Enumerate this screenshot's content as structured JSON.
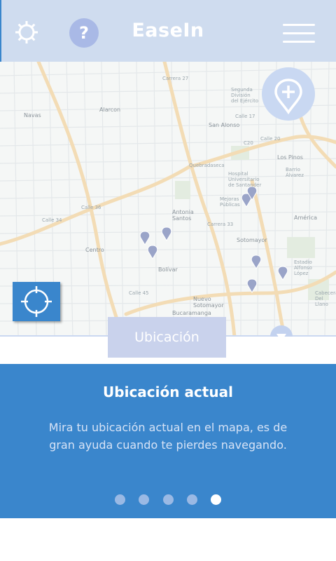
{
  "header": {
    "title": "EaseIn",
    "help_label": "?",
    "icons": [
      "gear-icon",
      "help-icon",
      "menu-icon"
    ]
  },
  "map": {
    "zoom_icon": "plus-pin-icon",
    "locate_icon": "crosshair-icon",
    "location_button": "Ubicación",
    "down_icon": "chevron-down-icon",
    "labels": {
      "navas": "Navas",
      "alarcon": "Alarcon",
      "san_alonso": "San Alonso",
      "segunda_division": "Segunda División del Ejército",
      "los_pinos": "Los Pinos",
      "barrio_alvarez": "Barrio Álvarez",
      "mejoras_publicas": "Mejoras Públicas",
      "hospital": "Hospital Universitario de Santander",
      "antonia_santos": "Antonia Santos",
      "sotomayor": "Sotomayor",
      "centro": "Centro",
      "bolivar": "Bolívar",
      "america": "América",
      "nuevo_sotomayor": "Nuevo Sotomayor",
      "bucaramanga": "Bucaramanga",
      "cabecera": "Cabecera Del Llano",
      "estadio": "Estadio Alfonso López",
      "calle_20": "Calle 20",
      "c20": "C20",
      "quebradaseca": "Quebradaseca",
      "carrera_27": "Carrera 27",
      "carrera_33": "Carrera 33",
      "calle_45": "Calle 45",
      "calle_36": "Calle 36",
      "calle_34": "Calle 34",
      "calle_17": "Calle 17"
    }
  },
  "panel": {
    "title": "Ubicación actual",
    "description": "Mira tu ubicación actual en el mapa, es de gran ayuda cuando te pierdes navegando.",
    "page_count": 5,
    "active_page": 5
  },
  "colors": {
    "primary": "#3a86cc",
    "header_bg": "#cfdcef",
    "accent_light": "#c9d2ec"
  }
}
